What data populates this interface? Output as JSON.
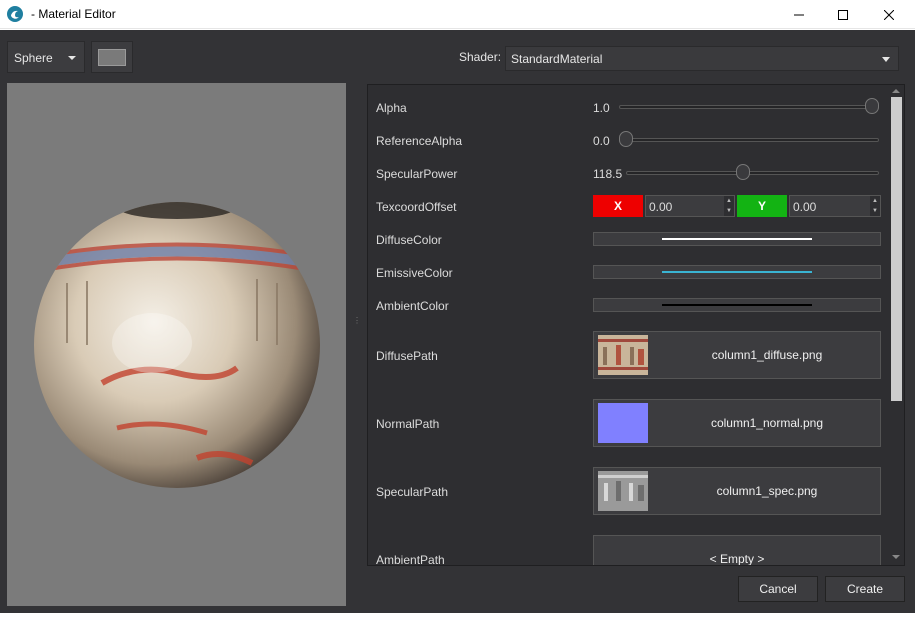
{
  "window": {
    "title": "- Material Editor"
  },
  "toolbar": {
    "mesh_value": "Sphere",
    "shader_label": "Shader:",
    "shader_value": "StandardMaterial"
  },
  "properties": {
    "alpha": {
      "label": "Alpha",
      "value": "1.0",
      "fraction": 1.0
    },
    "reference_alpha": {
      "label": "ReferenceAlpha",
      "value": "0.0",
      "fraction": 0.0
    },
    "specular_power": {
      "label": "SpecularPower",
      "value": "118.5",
      "fraction": 0.46
    },
    "texcoord_offset": {
      "label": "TexcoordOffset",
      "x_label": "X",
      "x_value": "0.00",
      "y_label": "Y",
      "y_value": "0.00"
    },
    "diffuse_color": {
      "label": "DiffuseColor",
      "color": "#ffffff"
    },
    "emissive_color": {
      "label": "EmissiveColor",
      "color": "#3ab4d2"
    },
    "ambient_color": {
      "label": "AmbientColor",
      "color": "#000000"
    },
    "diffuse_path": {
      "label": "DiffusePath",
      "file": "column1_diffuse.png"
    },
    "normal_path": {
      "label": "NormalPath",
      "file": "column1_normal.png",
      "thumb_color": "#8080ff"
    },
    "specular_path": {
      "label": "SpecularPath",
      "file": "column1_spec.png"
    },
    "ambient_path": {
      "label": "AmbientPath",
      "file": "< Empty >"
    }
  },
  "buttons": {
    "cancel": "Cancel",
    "create": "Create"
  },
  "icons": {
    "app": "app-logo-icon",
    "minimize": "minimize-icon",
    "maximize": "maximize-icon",
    "close": "close-icon"
  }
}
